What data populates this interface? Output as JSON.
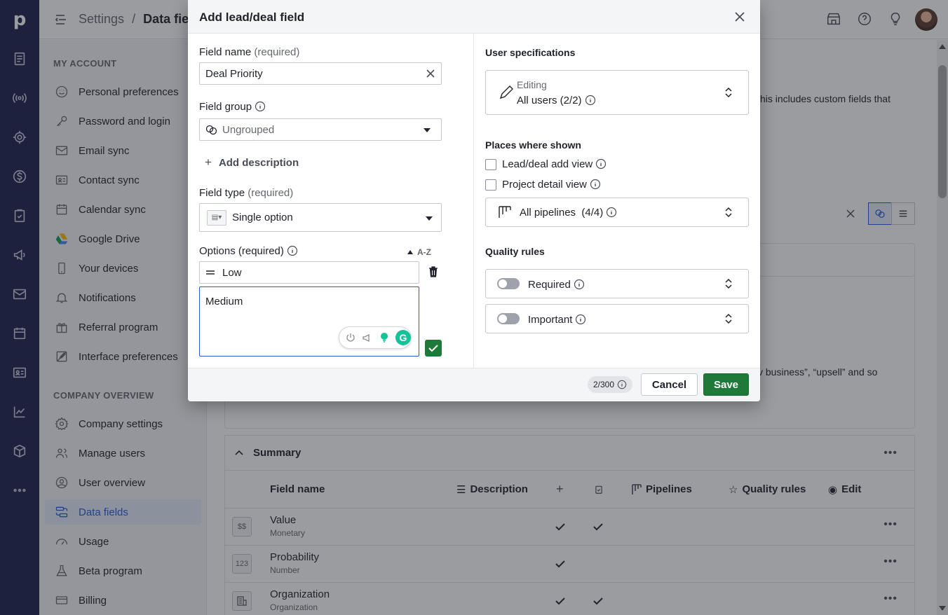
{
  "header": {
    "crumb_parent": "Settings",
    "crumb_separator": "/",
    "crumb_current": "Data field"
  },
  "rail": {
    "logo": "p",
    "icons": [
      "deals-icon",
      "broadcast-icon",
      "target-icon",
      "dollar-icon",
      "clipboard-icon",
      "megaphone-icon",
      "mail-icon",
      "calendar-icon",
      "contacts-icon",
      "chart-icon",
      "box-icon",
      "more-icon"
    ]
  },
  "sidebar": {
    "my_account_title": "MY ACCOUNT",
    "my_account": [
      {
        "label": "Personal preferences",
        "icon": "smiley-icon"
      },
      {
        "label": "Password and login",
        "icon": "key-icon"
      },
      {
        "label": "Email sync",
        "icon": "envelope-icon"
      },
      {
        "label": "Contact sync",
        "icon": "contact-card-icon"
      },
      {
        "label": "Calendar sync",
        "icon": "calendar-icon"
      },
      {
        "label": "Google Drive",
        "icon": "google-drive-icon"
      },
      {
        "label": "Your devices",
        "icon": "phone-icon"
      },
      {
        "label": "Notifications",
        "icon": "bell-icon"
      },
      {
        "label": "Referral program",
        "icon": "gift-icon"
      },
      {
        "label": "Interface preferences",
        "icon": "edit-square-icon"
      }
    ],
    "company_title": "COMPANY OVERVIEW",
    "company": [
      {
        "label": "Company settings",
        "icon": "gear-icon"
      },
      {
        "label": "Manage users",
        "icon": "users-icon"
      },
      {
        "label": "User overview",
        "icon": "user-circle-icon"
      },
      {
        "label": "Data fields",
        "icon": "data-fields-icon",
        "active": true
      },
      {
        "label": "Usage",
        "icon": "gauge-icon"
      },
      {
        "label": "Beta program",
        "icon": "flask-icon"
      },
      {
        "label": "Billing",
        "icon": "credit-card-icon"
      }
    ]
  },
  "main": {
    "description_fragment": "his includes custom fields that",
    "description_fragment_2": "v business”, “upsell” and so",
    "summary": {
      "title": "Summary",
      "columns": {
        "field_name": "Field name",
        "description": "Description",
        "pipelines": "Pipelines",
        "quality_rules": "Quality rules",
        "edit": "Edit"
      },
      "rows": [
        {
          "name": "Value",
          "type": "Monetary",
          "type_icon": "$$",
          "add": true,
          "detail": true
        },
        {
          "name": "Probability",
          "type": "Number",
          "type_icon": "123",
          "add": true,
          "detail": false
        },
        {
          "name": "Organization",
          "type": "Organization",
          "type_icon": "org",
          "add": true,
          "detail": true
        }
      ]
    }
  },
  "modal": {
    "title": "Add lead/deal field",
    "field_name_label": "Field name",
    "required_suffix": "(required)",
    "field_name_value": "Deal Priority",
    "field_group_label": "Field group",
    "field_group_value": "Ungrouped",
    "add_description": "Add description",
    "field_type_label": "Field type",
    "field_type_value": "Single option",
    "options_label": "Options (required)",
    "sort_label": "A-Z",
    "options": [
      "Low"
    ],
    "option_editing": "Medium",
    "user_specs_title": "User specifications",
    "editing_label": "Editing",
    "editing_value": "All users (2/2)",
    "places_title": "Places where shown",
    "place_add_view": "Lead/deal add view",
    "place_detail_view": "Project detail view",
    "pipelines_value": "All pipelines  (4/4)",
    "quality_title": "Quality rules",
    "required_rule": "Required",
    "important_rule": "Important",
    "counter": "2/300",
    "cancel": "Cancel",
    "save": "Save"
  },
  "colors": {
    "rail": "#1c1f4b",
    "accent": "#2659d6",
    "save": "#1f7a3a",
    "grammarly": "#15c39a"
  }
}
